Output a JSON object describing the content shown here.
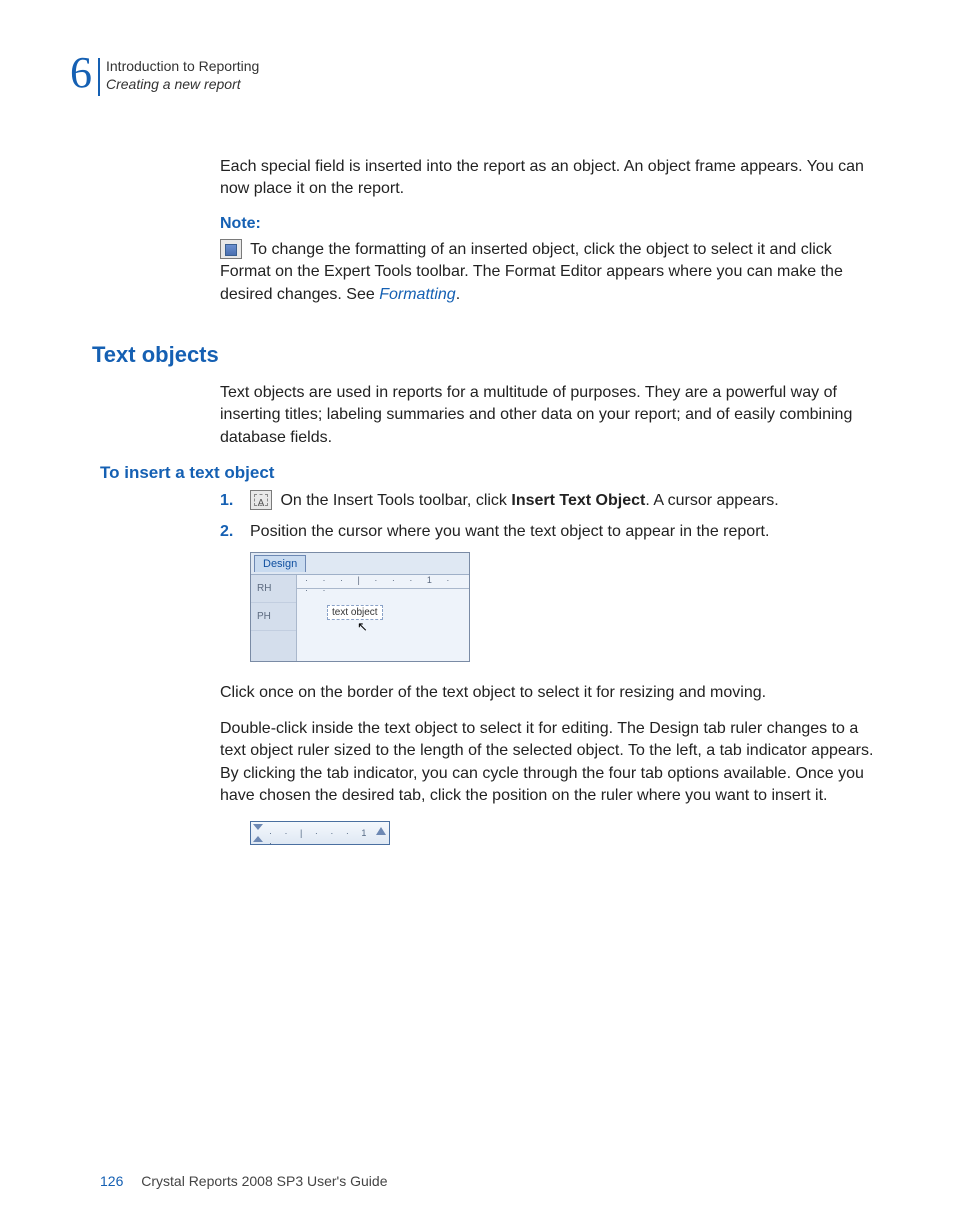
{
  "chapter": {
    "number": "6",
    "breadcrumb_main": "Introduction to Reporting",
    "breadcrumb_sub": "Creating a new report"
  },
  "paragraphs": {
    "intro1": "Each special field is inserted into the report as an object. An object frame appears. You can now place it on the report.",
    "note_label": "Note:",
    "note_body_a": " To change the formatting of an inserted object, click the object to select it and click Format on the Expert Tools toolbar. The Format Editor appears where you can make the desired changes. See ",
    "note_link": "Formatting",
    "note_body_b": ".",
    "textobjects_desc": "Text objects are used in reports for a multitude of purposes. They are a powerful way of inserting titles; labeling summaries and other data on your report; and of easily combining database fields.",
    "step1_a": " On the Insert Tools toolbar, click ",
    "step1_bold": "Insert Text Object",
    "step1_b": ". A cursor appears.",
    "step2": "Position the cursor where you want the text object to appear in the report.",
    "after1": "Click once on the border of the text object to select it for resizing and moving.",
    "after2": "Double-click inside the text object to select it for editing. The Design tab ruler changes to a text object ruler sized to the length of the selected object. To the left, a tab indicator appears. By clicking the tab indicator, you can cycle through the four tab options available. Once you have chosen the desired tab, click the position on the ruler where you want to insert it."
  },
  "headings": {
    "text_objects": "Text objects",
    "to_insert": "To insert a text object"
  },
  "steps": {
    "n1": "1.",
    "n2": "2."
  },
  "screenshot1": {
    "tab": "Design",
    "section_rh": "RH",
    "section_ph": "PH",
    "ruler_marks": "· · · | · · · 1 · · ·",
    "frame_text": "text object"
  },
  "screenshot2": {
    "ruler_marks": "· · | · · · 1 ·"
  },
  "footer": {
    "page": "126",
    "title": "Crystal Reports 2008 SP3 User's Guide"
  }
}
